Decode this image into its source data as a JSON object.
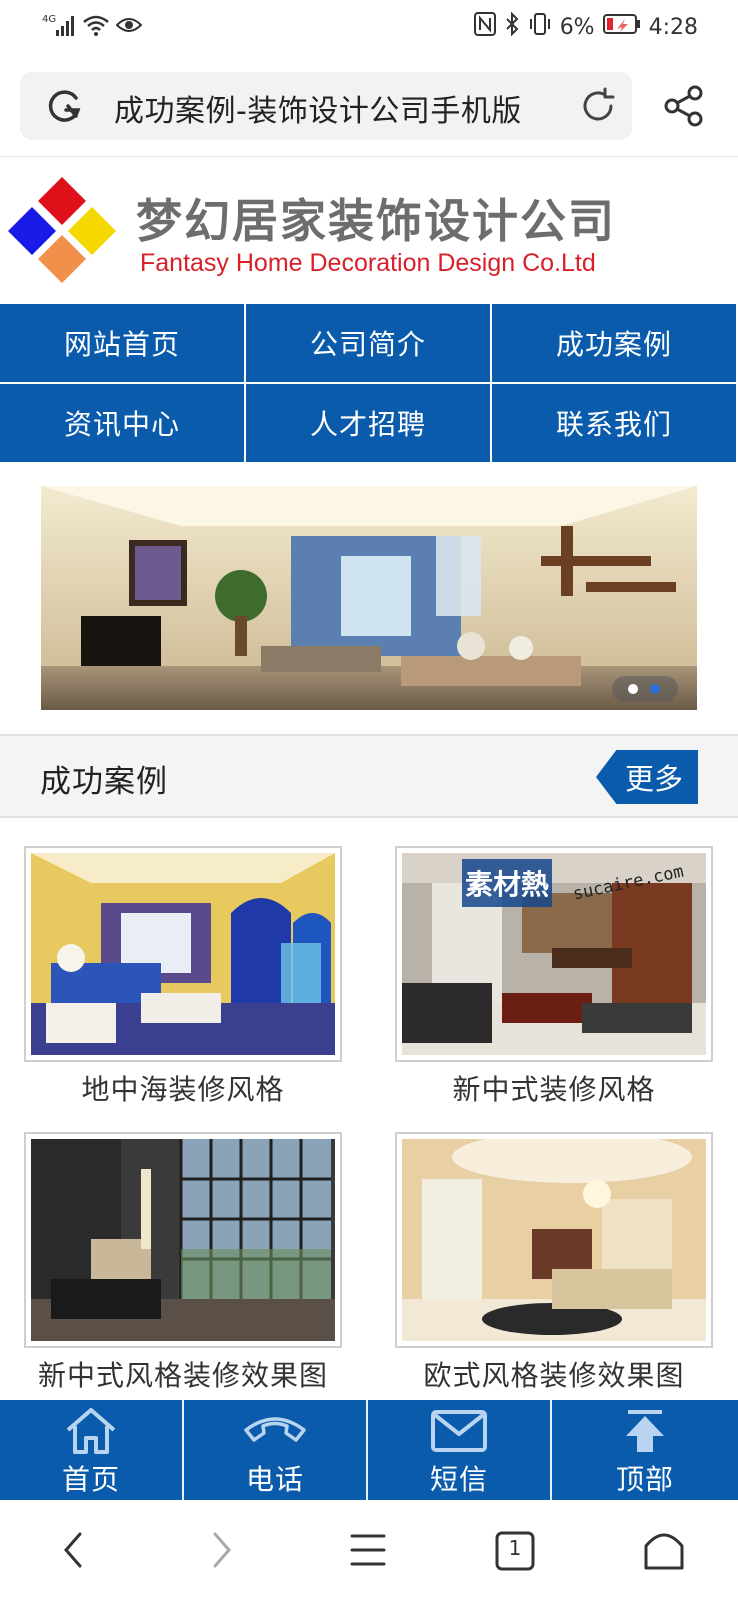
{
  "status_bar": {
    "network": "4G",
    "battery_percent": "6%",
    "time": "4:28"
  },
  "browser": {
    "page_title": "成功案例-装饰设计公司手机版"
  },
  "header": {
    "company_name_cn": "梦幻居家装饰设计公司",
    "company_name_en": "Fantasy Home Decoration Design Co.Ltd"
  },
  "nav": {
    "items": [
      {
        "label": "网站首页"
      },
      {
        "label": "公司简介"
      },
      {
        "label": "成功案例"
      },
      {
        "label": "资讯中心"
      },
      {
        "label": "人才招聘"
      },
      {
        "label": "联系我们"
      }
    ]
  },
  "banner": {
    "slide_count": 2,
    "active_slide": 2
  },
  "section": {
    "title": "成功案例",
    "more_label": "更多"
  },
  "cases": [
    {
      "label": "地中海装修风格"
    },
    {
      "label": "新中式装修风格",
      "watermark_cn": "素材熱",
      "watermark_en": "sucaire.com"
    },
    {
      "label": "新中式风格装修效果图"
    },
    {
      "label": "欧式风格装修效果图"
    }
  ],
  "toolbar": {
    "items": [
      {
        "label": "首页",
        "icon": "home-icon"
      },
      {
        "label": "电话",
        "icon": "phone-icon"
      },
      {
        "label": "短信",
        "icon": "mail-icon"
      },
      {
        "label": "顶部",
        "icon": "arrow-up-icon"
      }
    ]
  },
  "system_nav": {
    "tab_count": "1"
  },
  "colors": {
    "brand_blue": "#0a5bab",
    "logo_red": "#d8202a"
  }
}
